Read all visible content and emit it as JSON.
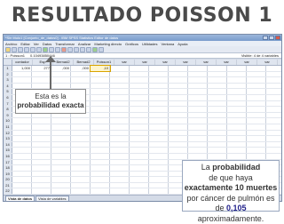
{
  "slide": {
    "title": "RESULTADO POISSON 1"
  },
  "window": {
    "title": "*Sin título1 [Conjunto_de_datos0] - IBM SPSS Statistics Editor de datos",
    "menu": [
      "Archivo",
      "Editar",
      "Ver",
      "Datos",
      "Transformar",
      "Analizar",
      "Marketing directo",
      "Gráficos",
      "Utilidades",
      "Ventana",
      "Ayuda"
    ]
  },
  "cellbar": {
    "ref": "1 : Poisson1",
    "value": "0.10493850446",
    "visible": "Visible: 4 de 4 variables"
  },
  "grid": {
    "columns": [
      "contador",
      "Esp",
      "Bernad2",
      "Bernad2",
      "Poisson1",
      "var",
      "var",
      "var",
      "var",
      "var",
      "var",
      "var",
      "var"
    ],
    "first_row": [
      "1,000",
      "277",
      ",000",
      ",000",
      ",10",
      "",
      "",
      "",
      "",
      "",
      "",
      "",
      ""
    ],
    "row_numbers": [
      "1",
      "2",
      "3",
      "4",
      "5",
      "6",
      "7",
      "8",
      "9",
      "10",
      "11",
      "12",
      "13",
      "14",
      "15",
      "16",
      "17",
      "18",
      "19",
      "20",
      "21",
      "22",
      "23",
      "24",
      "25",
      "26"
    ]
  },
  "tabs": {
    "data_view": "Vista de datos",
    "variable_view": "Vista de variables"
  },
  "callout_left": {
    "line1": "Esta es la",
    "line2": "probabilidad exacta"
  },
  "callout_right": {
    "line1_a": "La ",
    "line1_b": "probabilidad",
    "line2": "de que haya",
    "line3": "exactamente 10 muertes",
    "line4": "por cáncer de pulmón es",
    "line5_a": "de ",
    "line5_b": "0,105",
    "line6": "aproximadamente."
  }
}
